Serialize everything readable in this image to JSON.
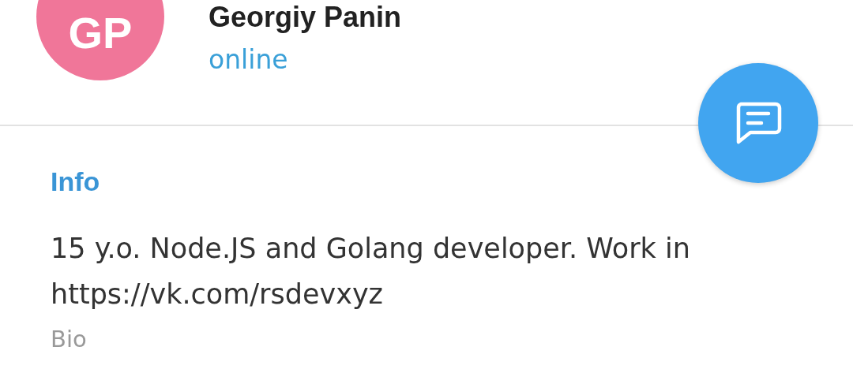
{
  "profile": {
    "avatar_initials": "GP",
    "name": "Georgiy Panin",
    "status": "online"
  },
  "info": {
    "title": "Info",
    "bio": "15 y.o. Node.JS and Golang developer. Work in https://vk.com/rsdevxyz",
    "bio_label": "Bio"
  }
}
